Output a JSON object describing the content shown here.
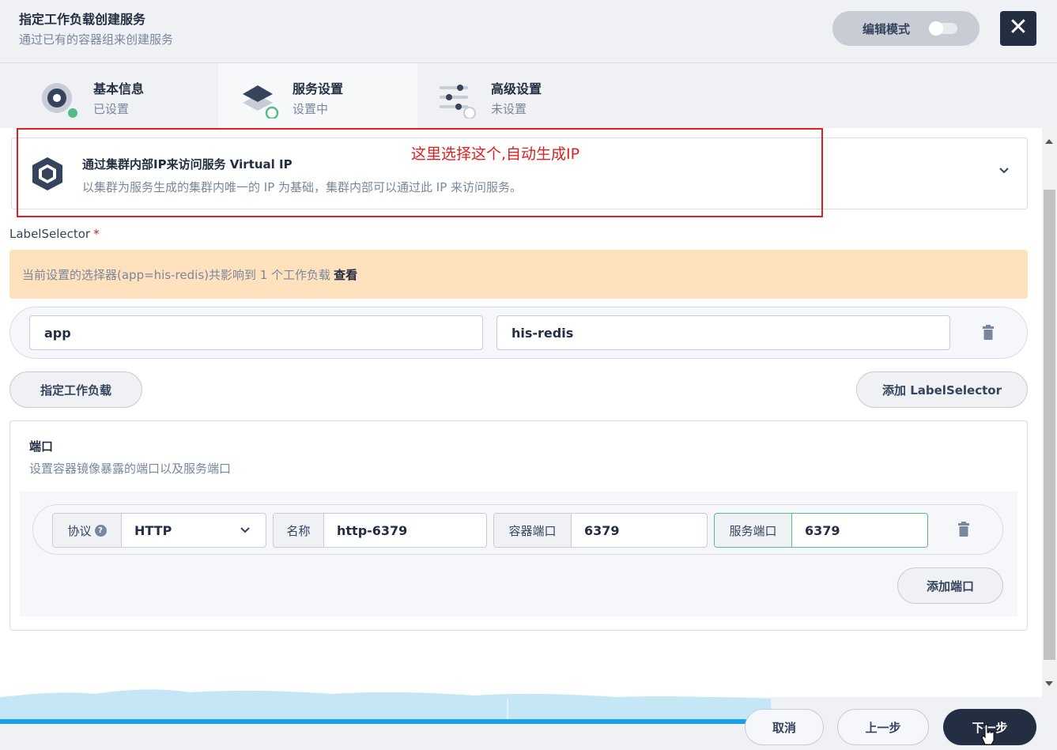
{
  "header": {
    "title": "指定工作负载创建服务",
    "subtitle": "通过已有的容器组来创建服务",
    "edit_mode_label": "编辑模式",
    "close_icon": "close-icon"
  },
  "tabs": [
    {
      "label": "基本信息",
      "status": "已设置",
      "icon": "basic-info-icon"
    },
    {
      "label": "服务设置",
      "status": "设置中",
      "icon": "layers-icon"
    },
    {
      "label": "高级设置",
      "status": "未设置",
      "icon": "sliders-icon"
    }
  ],
  "service_type": {
    "name": "通过集群内部IP来访问服务 Virtual IP",
    "description": "以集群为服务生成的集群内唯一的 IP 为基础，集群内部可以通过此 IP 来访问服务。"
  },
  "annotation": {
    "text": "这里选择这个,自动生成IP",
    "color": "#e02020"
  },
  "label_selector": {
    "label": "LabelSelector",
    "required_mark": "*",
    "warning_text": "当前设置的选择器(app=his-redis)共影响到 1 个工作负载",
    "warning_link": "查看",
    "key": "app",
    "value": "his-redis",
    "specify_workload_button": "指定工作负载",
    "add_button": "添加 LabelSelector"
  },
  "ports": {
    "title": "端口",
    "description": "设置容器镜像暴露的端口以及服务端口",
    "protocol_label": "协议",
    "protocol_value": "HTTP",
    "name_label": "名称",
    "name_value": "http-6379",
    "container_port_label": "容器端口",
    "container_port_value": "6379",
    "service_port_label": "服务端口",
    "service_port_value": "6379",
    "add_port_button": "添加端口"
  },
  "footer": {
    "cancel": "取消",
    "prev": "上一步",
    "next": "下一步"
  },
  "colors": {
    "primary_dark": "#242e42",
    "success": "#55bc8a",
    "warning_bg": "#ffe1be",
    "progress": "#1aa0e8"
  }
}
